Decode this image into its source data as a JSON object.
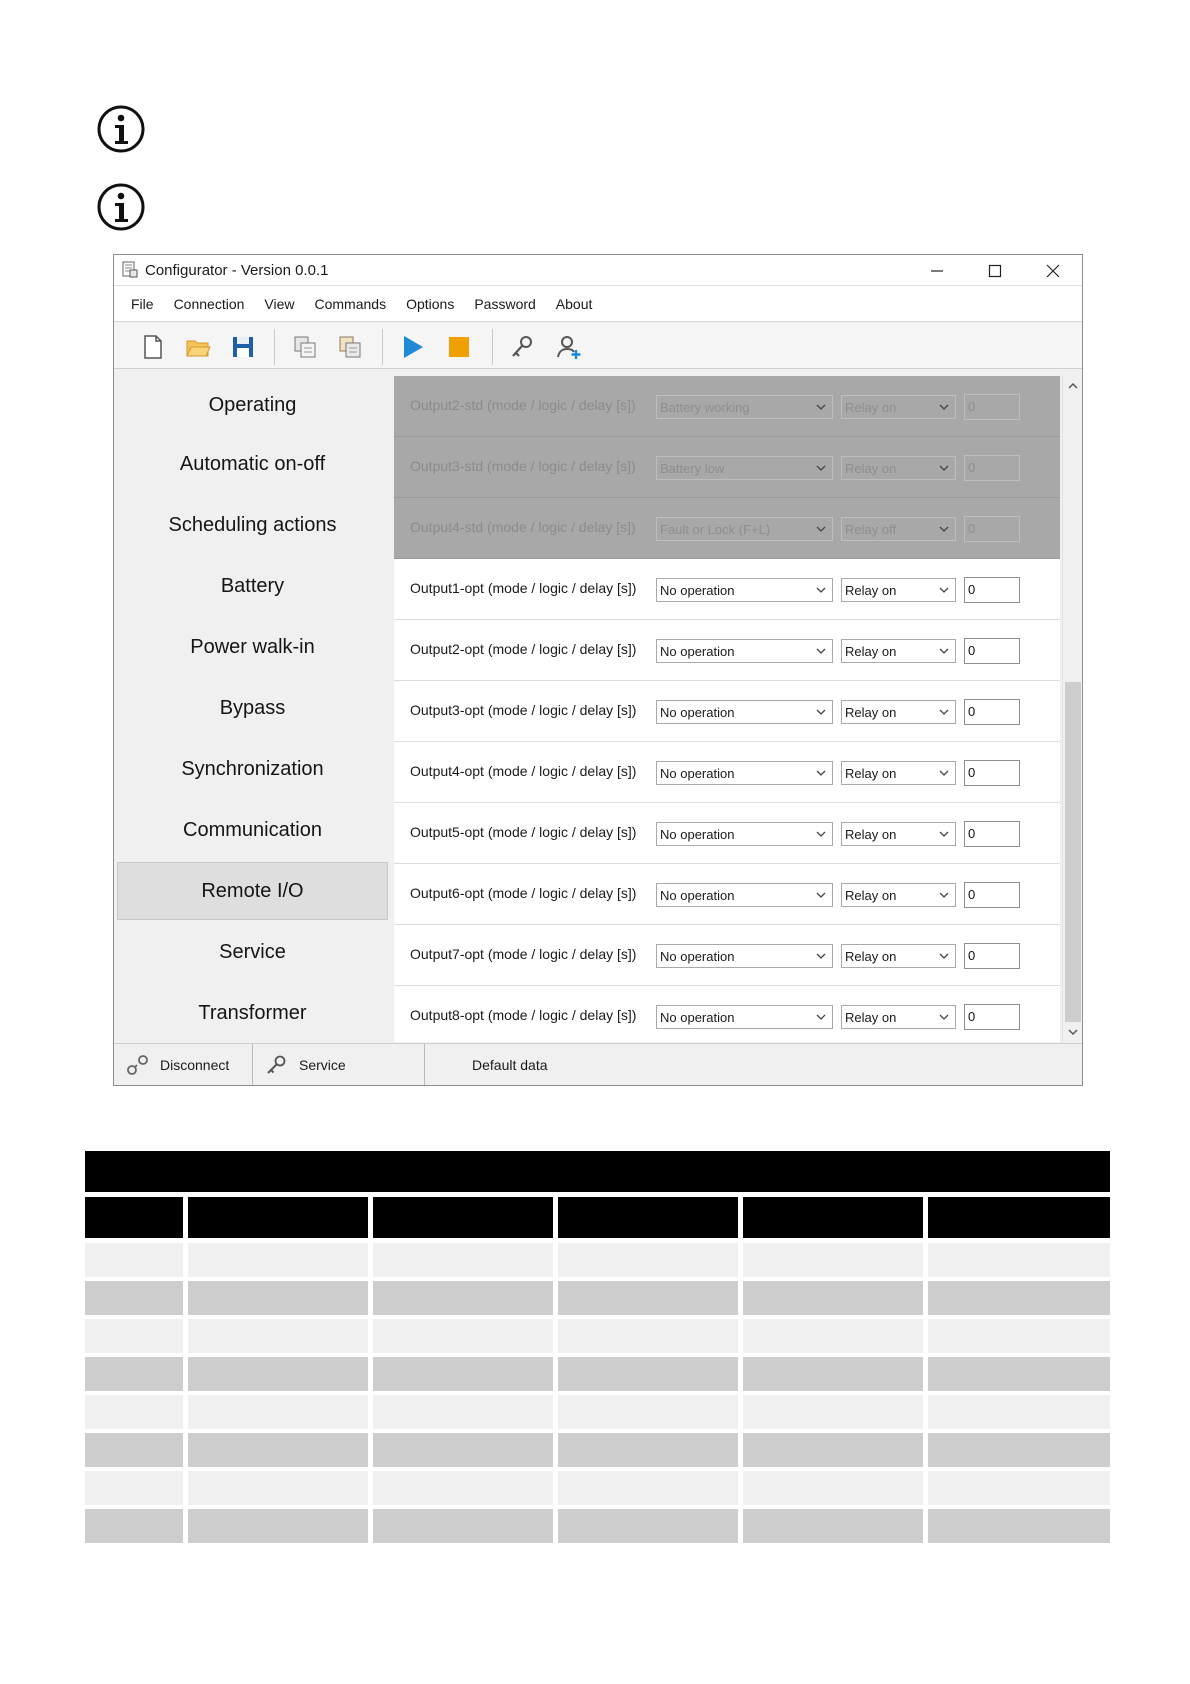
{
  "info_icons": [
    "info-icon",
    "info-icon"
  ],
  "window": {
    "title": "Configurator - Version 0.0.1",
    "menu": [
      "File",
      "Connection",
      "View",
      "Commands",
      "Options",
      "Password",
      "About"
    ]
  },
  "toolbar": {
    "icons": [
      "new-file-icon",
      "open-folder-icon",
      "save-icon",
      "copy-device-icon",
      "paste-device-icon",
      "play-icon",
      "stop-icon",
      "key-icon",
      "add-user-icon"
    ]
  },
  "sidebar": {
    "items": [
      "Operating",
      "Automatic on-off",
      "Scheduling actions",
      "Battery",
      "Power walk-in",
      "Bypass",
      "Synchronization",
      "Communication",
      "Remote I/O",
      "Service",
      "Transformer"
    ],
    "active": "Remote I/O"
  },
  "rows": [
    {
      "label": "Output2-std (mode / logic / delay [s])",
      "mode": "Battery working",
      "logic": "Relay on",
      "delay": "0",
      "enabled": false
    },
    {
      "label": "Output3-std (mode / logic / delay [s])",
      "mode": "Battery low",
      "logic": "Relay on",
      "delay": "0",
      "enabled": false
    },
    {
      "label": "Output4-std (mode / logic / delay [s])",
      "mode": "Fault or Lock (F+L)",
      "logic": "Relay off",
      "delay": "0",
      "enabled": false
    },
    {
      "label": "Output1-opt (mode / logic / delay [s])",
      "mode": "No operation",
      "logic": "Relay on",
      "delay": "0",
      "enabled": true
    },
    {
      "label": "Output2-opt (mode / logic / delay [s])",
      "mode": "No operation",
      "logic": "Relay on",
      "delay": "0",
      "enabled": true
    },
    {
      "label": "Output3-opt (mode / logic / delay [s])",
      "mode": "No operation",
      "logic": "Relay on",
      "delay": "0",
      "enabled": true
    },
    {
      "label": "Output4-opt (mode / logic / delay [s])",
      "mode": "No operation",
      "logic": "Relay on",
      "delay": "0",
      "enabled": true
    },
    {
      "label": "Output5-opt (mode / logic / delay [s])",
      "mode": "No operation",
      "logic": "Relay on",
      "delay": "0",
      "enabled": true
    },
    {
      "label": "Output6-opt (mode / logic / delay [s])",
      "mode": "No operation",
      "logic": "Relay on",
      "delay": "0",
      "enabled": true
    },
    {
      "label": "Output7-opt (mode / logic / delay [s])",
      "mode": "No operation",
      "logic": "Relay on",
      "delay": "0",
      "enabled": true
    },
    {
      "label": "Output8-opt (mode / logic / delay [s])",
      "mode": "No operation",
      "logic": "Relay on",
      "delay": "0",
      "enabled": true
    }
  ],
  "statusbar": {
    "disconnect": "Disconnect",
    "service": "Service",
    "default_data": "Default data"
  },
  "colors": {
    "disabled_row": "#a8a8a8",
    "active_nav": "#dedede",
    "play": "#1e8ad6",
    "stop": "#f0a000",
    "table_header": "#000000",
    "table_row_light": "#f0f0f0",
    "table_row_dark": "#cdcdcd"
  }
}
